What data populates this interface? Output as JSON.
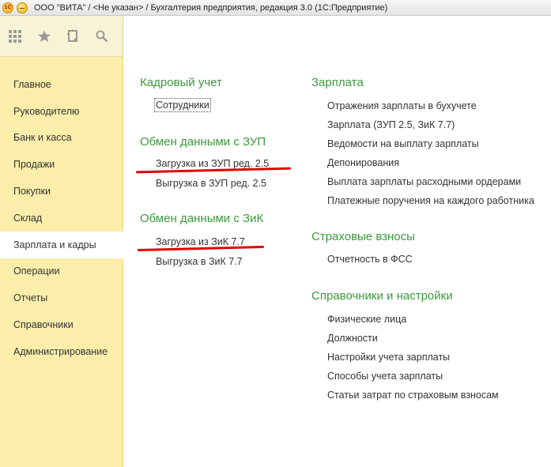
{
  "window": {
    "logo_text": "1С",
    "title": "ООО \"ВИТА\" / <Не указан> / Бухгалтерия предприятия, редакция 3.0  (1С:Предприятие)"
  },
  "sidebar": {
    "tools": [
      "apps-grid-icon",
      "star-icon",
      "history-icon",
      "search-icon"
    ],
    "items": [
      {
        "label": "Главное"
      },
      {
        "label": "Руководителю"
      },
      {
        "label": "Банк и касса"
      },
      {
        "label": "Продажи"
      },
      {
        "label": "Покупки"
      },
      {
        "label": "Склад"
      },
      {
        "label": "Зарплата и кадры",
        "active": true
      },
      {
        "label": "Операции"
      },
      {
        "label": "Отчеты"
      },
      {
        "label": "Справочники"
      },
      {
        "label": "Администрирование"
      }
    ]
  },
  "left_column": {
    "hr": {
      "title": "Кадровый учет",
      "links": [
        "Сотрудники"
      ]
    },
    "zup": {
      "title": "Обмен данными с ЗУП",
      "links": [
        "Загрузка из ЗУП ред. 2.5",
        "Выгрузка в ЗУП ред. 2.5"
      ]
    },
    "zik": {
      "title": "Обмен данными с ЗиК",
      "links": [
        "Загрузка из ЗиК 7.7",
        "Выгрузка в ЗиК 7.7"
      ]
    }
  },
  "right_column": {
    "salary": {
      "title": "Зарплата",
      "links": [
        "Отражения зарплаты в бухучете",
        "Зарплата (ЗУП 2.5, ЗиК 7.7)",
        "Ведомости на выплату зарплаты",
        "Депонирования",
        "Выплата зарплаты расходными ордерами",
        "Платежные поручения на каждого работника"
      ]
    },
    "insurance": {
      "title": "Страховые взносы",
      "links": [
        "Отчетность в ФСС"
      ]
    },
    "refs": {
      "title": "Справочники и настройки",
      "links": [
        "Физические лица",
        "Должности",
        "Настройки учета зарплаты",
        "Способы учета зарплаты",
        "Статьи затрат по страховым взносам"
      ]
    }
  },
  "colors": {
    "sidebar_bg": "#fbeeab",
    "group_title": "#3c9a3c",
    "annotation": "#e30000"
  }
}
